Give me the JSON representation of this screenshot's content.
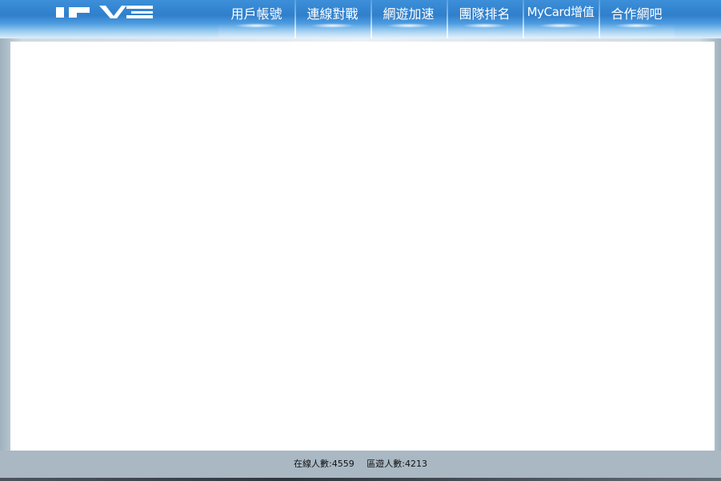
{
  "brand": {
    "logo_text": "IPVE"
  },
  "nav": {
    "items": [
      {
        "label": "用戶帳號"
      },
      {
        "label": "連線對戰"
      },
      {
        "label": "網遊加速"
      },
      {
        "label": "團隊排名"
      },
      {
        "label": "MyCard增值"
      },
      {
        "label": "合作網吧"
      }
    ]
  },
  "footer": {
    "online_label": "在線人數:",
    "online_count": "4559",
    "zone_label": "區遊人數:",
    "zone_count": "4213"
  },
  "colors": {
    "header_blue": "#2f7fcc",
    "footer_gray": "#a9b8c3"
  }
}
